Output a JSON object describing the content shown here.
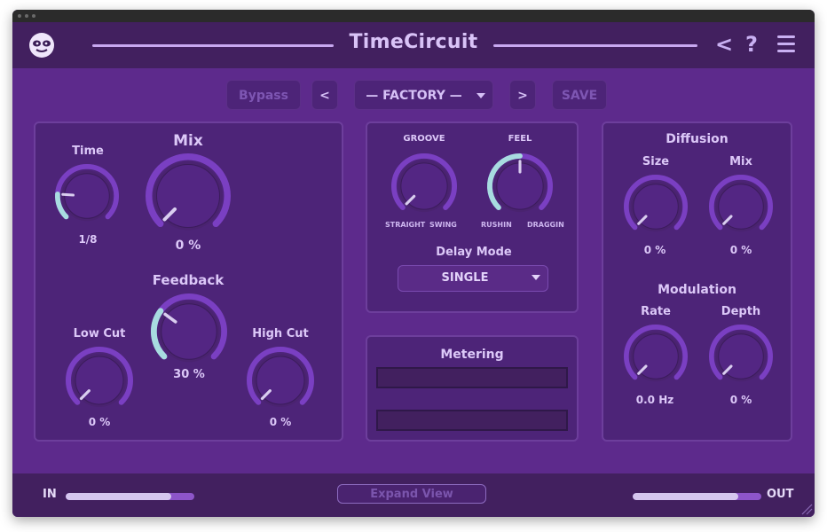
{
  "app": {
    "title": "TimeCircuit"
  },
  "toolbar": {
    "bypass_label": "Bypass",
    "prev_label": "<",
    "preset_label": "— FACTORY —",
    "next_label": ">",
    "save_label": "SAVE"
  },
  "header_icons": {
    "back": "<",
    "help": "?"
  },
  "delay": {
    "time": {
      "label": "Time",
      "value": "1/8",
      "level": 0.18
    },
    "mix": {
      "label": "Mix",
      "value": "0 %",
      "level": 0.0
    },
    "feedback": {
      "label": "Feedback",
      "value": "30 %",
      "level": 0.3
    },
    "low_cut": {
      "label": "Low Cut",
      "value": "0 %",
      "level": 0.0
    },
    "high_cut": {
      "label": "High Cut",
      "value": "0 %",
      "level": 0.0
    }
  },
  "groove": {
    "label": "GROOVE",
    "left": "STRAIGHT",
    "right": "SWING",
    "level": 0.0
  },
  "feel": {
    "label": "FEEL",
    "left": "RUSHIN",
    "right": "DRAGGIN",
    "level": 0.5
  },
  "delay_mode": {
    "label": "Delay Mode",
    "value": "SINGLE"
  },
  "metering": {
    "title": "Metering"
  },
  "diffusion": {
    "title": "Diffusion",
    "size": {
      "label": "Size",
      "value": "0 %",
      "level": 0.0
    },
    "mix": {
      "label": "Mix",
      "value": "0 %",
      "level": 0.0
    }
  },
  "modulation": {
    "title": "Modulation",
    "rate": {
      "label": "Rate",
      "value": "0.0 Hz",
      "level": 0.0
    },
    "depth": {
      "label": "Depth",
      "value": "0 %",
      "level": 0.0
    }
  },
  "footer": {
    "in_label": "IN",
    "out_label": "OUT",
    "expand_label": "Expand View",
    "in_level": 0.82,
    "out_level": 0.82
  },
  "colors": {
    "background": "#5d2a8c",
    "panel": "#4d2478",
    "header": "#42205f",
    "knob_arc": "#7a3fc2",
    "value_arc": "#a8dce0",
    "text": "#dcc8f8"
  }
}
